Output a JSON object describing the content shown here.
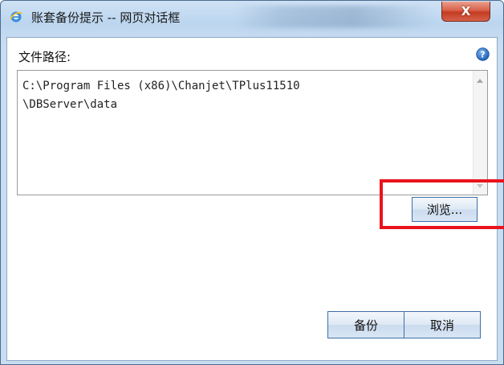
{
  "window": {
    "title": "账套备份提示 -- 网页对话框",
    "close_glyph": "X",
    "app_icon": "ie-icon"
  },
  "form": {
    "path_label": "文件路径:",
    "help_icon": "help-icon",
    "path_value": "C:\\Program Files (x86)\\Chanjet\\TPlus11510\n\\DBServer\\data"
  },
  "buttons": {
    "browse_label": "浏览...",
    "backup_label": "备份",
    "cancel_label": "取消"
  },
  "colors": {
    "highlight": "#e8141c",
    "title_bar": "#c9ddf1",
    "close_button": "#c33b22"
  }
}
